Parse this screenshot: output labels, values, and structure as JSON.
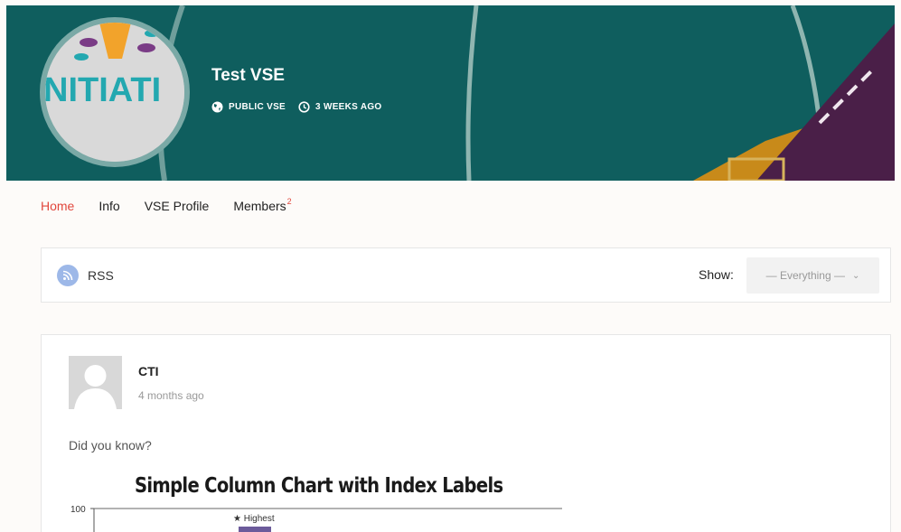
{
  "group": {
    "title": "Test VSE",
    "logo_text": "NITIATI",
    "visibility": "PUBLIC VSE",
    "active": "3 WEEKS AGO"
  },
  "nav": {
    "items": [
      {
        "label": "Home",
        "active": true
      },
      {
        "label": "Info"
      },
      {
        "label": "VSE Profile"
      },
      {
        "label": "Members",
        "count": "2"
      }
    ]
  },
  "filter": {
    "rss_label": "RSS",
    "show_label": "Show:",
    "show_value": "— Everything —"
  },
  "activity": {
    "author": "CTI",
    "time": "4 months ago",
    "text": "Did you know?"
  },
  "chart_data": {
    "type": "bar",
    "title": "Simple Column Chart with Index Labels",
    "yticks": [
      100
    ],
    "index_labels": [
      "★ Highest"
    ],
    "bar_color": "#6c5b9b"
  },
  "colors": {
    "cover": "#0f5e5e",
    "accent": "#e1473d",
    "logo_text": "#23a8b0"
  }
}
